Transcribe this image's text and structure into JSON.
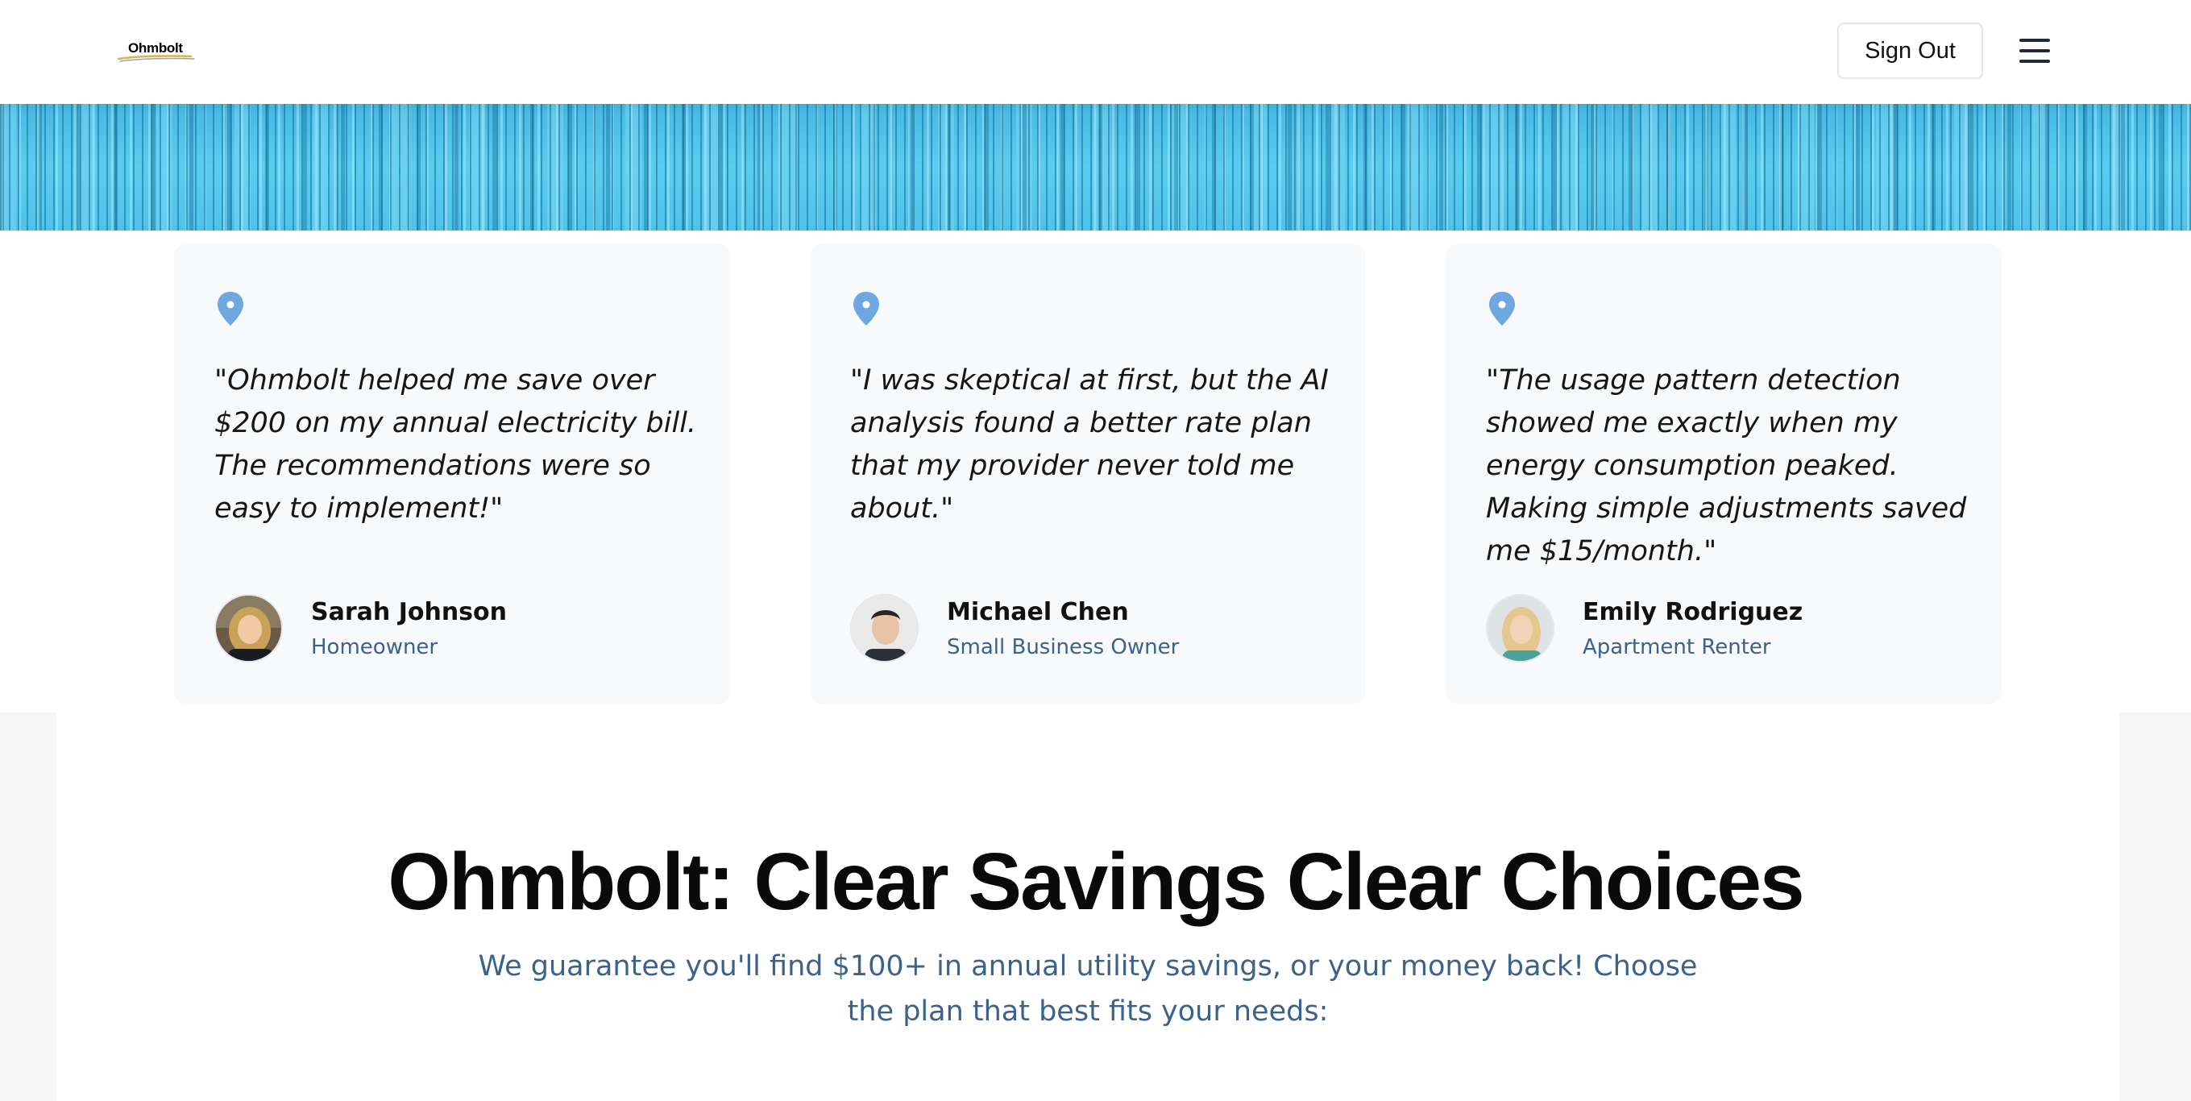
{
  "header": {
    "logo_text": "Ohmbolt",
    "sign_out_label": "Sign Out",
    "menu_icon": "hamburger-menu-icon"
  },
  "testimonials": [
    {
      "icon": "map-pin-icon",
      "quote": "\"Ohmbolt helped me save over $200 on my annual electricity bill. The recommendations were so easy to implement!\"",
      "name": "Sarah Johnson",
      "role": "Homeowner"
    },
    {
      "icon": "map-pin-icon",
      "quote": "\"I was skeptical at first, but the AI analysis found a better rate plan that my provider never told me about.\"",
      "name": "Michael Chen",
      "role": "Small Business Owner"
    },
    {
      "icon": "map-pin-icon",
      "quote": "\"The usage pattern detection showed me exactly when my energy consumption peaked. Making simple adjustments saved me $15/month.\"",
      "name": "Emily Rodriguez",
      "role": "Apartment Renter"
    }
  ],
  "pricing_intro": {
    "headline": "Ohmbolt: Clear Savings Clear Choices",
    "subtext": "We guarantee you'll find $100+ in annual utility savings, or your money back! Choose the plan that best fits your needs:"
  },
  "colors": {
    "accent_blue": "#6fa8e0",
    "banner_blue": "#52c6ec",
    "muted_text": "#3b6289",
    "card_bg": "#f8f9fa"
  }
}
